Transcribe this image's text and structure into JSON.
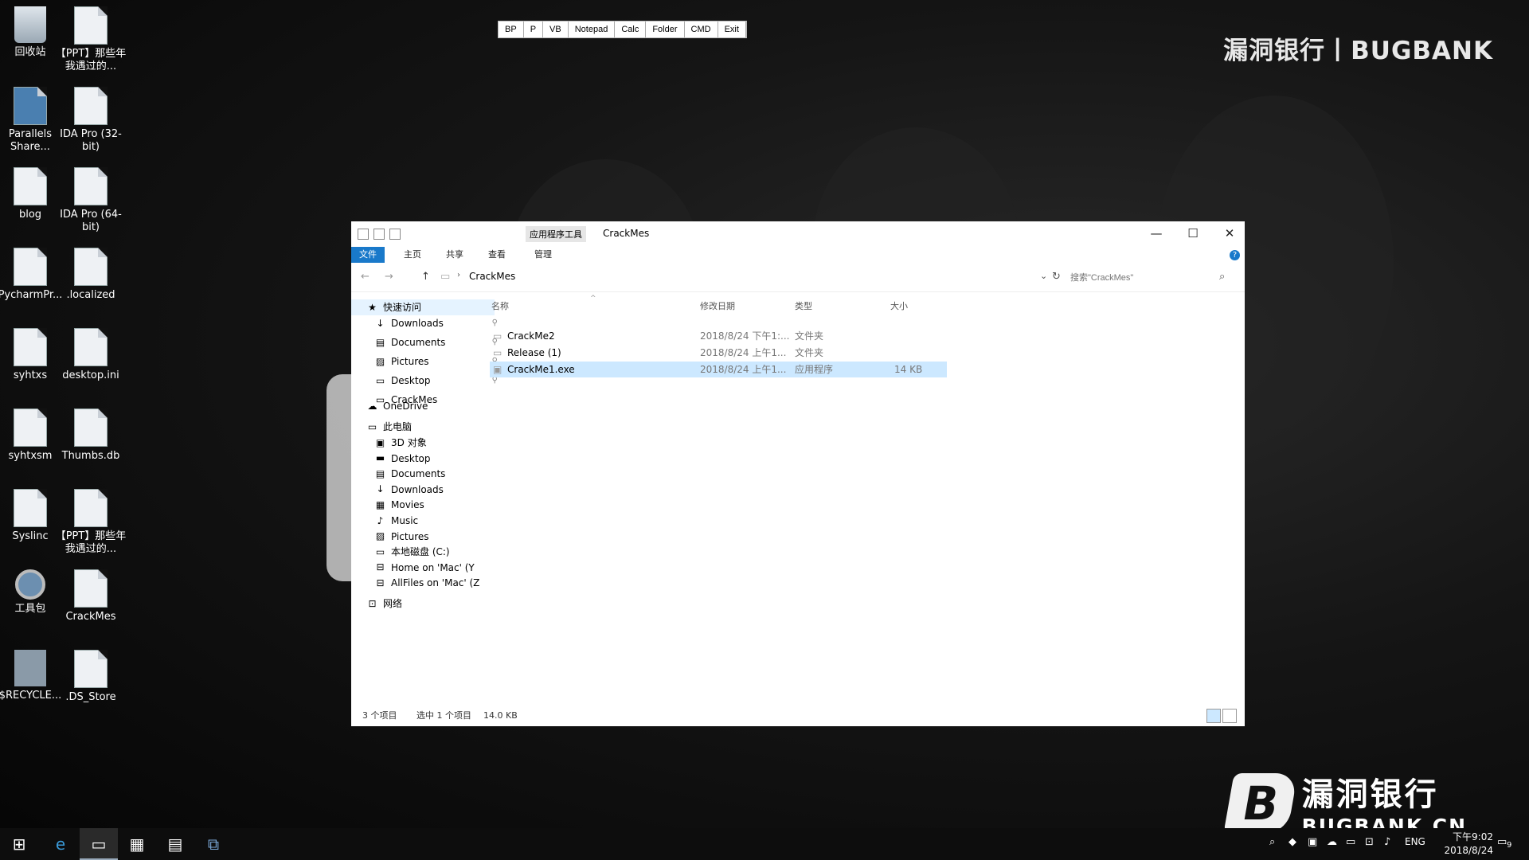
{
  "desktop": {
    "icons": [
      {
        "label": "回收站",
        "icon": "recycle-bin-icon"
      },
      {
        "label": "【PPT】那些年我遇过的...",
        "icon": "document-icon"
      },
      {
        "label": "Parallels Share...",
        "icon": "shortcut-icon"
      },
      {
        "label": "IDA Pro (32-bit)",
        "icon": "ida-pro-icon"
      },
      {
        "label": "blog",
        "icon": "folder-zip-icon"
      },
      {
        "label": "IDA Pro (64-bit)",
        "icon": "ida-pro-icon"
      },
      {
        "label": "PycharmPr...",
        "icon": "document-icon"
      },
      {
        "label": ".localized",
        "icon": "file-icon"
      },
      {
        "label": "syhtxs",
        "icon": "document-icon"
      },
      {
        "label": "desktop.ini",
        "icon": "settings-file-icon"
      },
      {
        "label": "syhtxsm",
        "icon": "document-icon"
      },
      {
        "label": "Thumbs.db",
        "icon": "settings-file-icon"
      },
      {
        "label": "Syslinc",
        "icon": "document-icon"
      },
      {
        "label": "【PPT】那些年我遇过的...",
        "icon": "document-icon"
      },
      {
        "label": "工具包",
        "icon": "magnifier-icon"
      },
      {
        "label": "CrackMes",
        "icon": "folder-zip-icon"
      },
      {
        "label": "$RECYCLE...",
        "icon": "folder-icon"
      },
      {
        "label": ".DS_Store",
        "icon": "file-icon"
      }
    ]
  },
  "top_toolbar": [
    "BP",
    "P",
    "VB",
    "Notepad",
    "Calc",
    "Folder",
    "CMD",
    "Exit"
  ],
  "watermark": {
    "top_text": "漏洞银行丨BUGBANK",
    "logo_letter": "B",
    "logo_cn": "漏洞银行",
    "logo_en": "BUGBANK.CN"
  },
  "explorer": {
    "context_tab": "应用程序工具",
    "title": "CrackMes",
    "ribbon_tabs": [
      "文件",
      "主页",
      "共享",
      "查看",
      "管理"
    ],
    "path": "CrackMes",
    "search_placeholder": "搜索\"CrackMes\"",
    "window_controls": {
      "minimize": "—",
      "maximize": "☐",
      "close": "✕"
    },
    "nav": {
      "quick_access": "快速访问",
      "quick_items": [
        "Downloads",
        "Documents",
        "Pictures",
        "Desktop",
        "CrackMes"
      ],
      "onedrive": "OneDrive",
      "this_pc": "此电脑",
      "pc_items": [
        "3D 对象",
        "Desktop",
        "Documents",
        "Downloads",
        "Movies",
        "Music",
        "Pictures",
        "本地磁盘 (C:)",
        "Home on 'Mac' (Y",
        "AllFiles on 'Mac' (Z"
      ],
      "network": "网络"
    },
    "columns": {
      "name": "名称",
      "date": "修改日期",
      "type": "类型",
      "size": "大小"
    },
    "files": [
      {
        "name": "CrackMe2",
        "date": "2018/8/24 下午1:...",
        "type": "文件夹",
        "size": ""
      },
      {
        "name": "Release (1)",
        "date": "2018/8/24 上午1...",
        "type": "文件夹",
        "size": ""
      },
      {
        "name": "CrackMe1.exe",
        "date": "2018/8/24 上午1...",
        "type": "应用程序",
        "size": "14 KB"
      }
    ],
    "status": {
      "count": "3 个项目",
      "selected": "选中 1 个项目",
      "size": "14.0 KB"
    }
  },
  "taskbar": {
    "tray_lang": "ENG",
    "time": "下午9:02",
    "date": "2018/8/24",
    "notification_count": "9"
  }
}
